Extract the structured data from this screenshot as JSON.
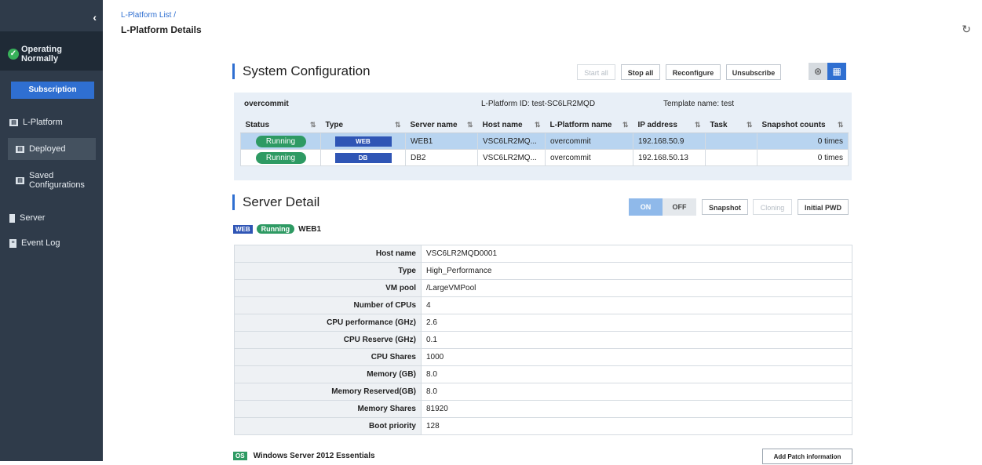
{
  "sidebar": {
    "status": "Operating Normally",
    "subscription": "Subscription",
    "lplatform": "L-Platform",
    "deployed": "Deployed",
    "saved_line1": "Saved",
    "saved_line2": "Configurations",
    "server": "Server",
    "event_log": "Event Log"
  },
  "header": {
    "breadcrumb": "L-Platform List /",
    "title": "L-Platform Details"
  },
  "system_config": {
    "title": "System Configuration",
    "buttons": {
      "start_all": "Start all",
      "stop_all": "Stop all",
      "reconfigure": "Reconfigure",
      "unsubscribe": "Unsubscribe"
    },
    "name": "overcommit",
    "lplatform_id": "L-Platform ID: test-SC6LR2MQD",
    "template_name": "Template name: test",
    "columns": [
      "Status",
      "Type",
      "Server name",
      "Host name",
      "L-Platform name",
      "IP address",
      "Task",
      "Snapshot counts"
    ],
    "rows": [
      {
        "status": "Running",
        "type": "WEB",
        "server": "WEB1",
        "host": "VSC6LR2MQ...",
        "lplatform": "overcommit",
        "ip": "192.168.50.9",
        "task": "",
        "snapshots": "0 times"
      },
      {
        "status": "Running",
        "type": "DB",
        "server": "DB2",
        "host": "VSC6LR2MQ...",
        "lplatform": "overcommit",
        "ip": "192.168.50.13",
        "task": "",
        "snapshots": "0 times"
      }
    ]
  },
  "server_detail": {
    "title": "Server Detail",
    "buttons": {
      "on": "ON",
      "off": "OFF",
      "snapshot": "Snapshot",
      "cloning": "Cloning",
      "initial_pwd": "Initial PWD"
    },
    "badge_type": "WEB",
    "badge_status": "Running",
    "badge_server": "WEB1",
    "fields": [
      {
        "label": "Host name",
        "value": "VSC6LR2MQD0001"
      },
      {
        "label": "Type",
        "value": "High_Performance"
      },
      {
        "label": "VM pool",
        "value": "/LargeVMPool"
      },
      {
        "label": "Number of CPUs",
        "value": "4"
      },
      {
        "label": "CPU performance (GHz)",
        "value": "2.6"
      },
      {
        "label": "CPU Reserve (GHz)",
        "value": "0.1"
      },
      {
        "label": "CPU Shares",
        "value": "1000"
      },
      {
        "label": "Memory (GB)",
        "value": "8.0"
      },
      {
        "label": "Memory Reserved(GB)",
        "value": "8.0"
      },
      {
        "label": "Memory Shares",
        "value": "81920"
      },
      {
        "label": "Boot priority",
        "value": "128"
      }
    ],
    "os_badge": "OS",
    "os_name": "Windows Server 2012 Essentials",
    "add_patch": "Add Patch information"
  }
}
